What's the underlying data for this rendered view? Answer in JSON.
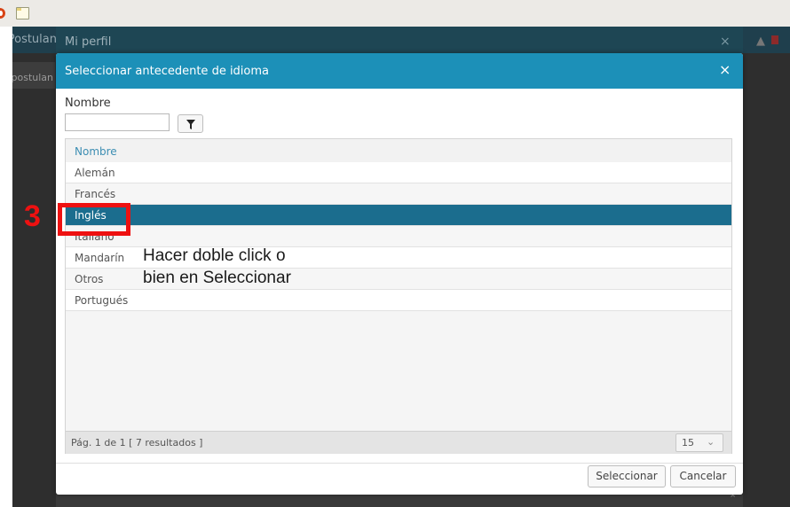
{
  "background": {
    "left_title_fragment": "Postulan",
    "side_fragment": "postulan",
    "outer_dialog_title": "Mi perfil",
    "outer_close": "×"
  },
  "modal": {
    "title": "Seleccionar antecedente de idioma",
    "close_glyph": "×",
    "filter_label": "Nombre",
    "filter_value": "",
    "grid": {
      "column_header": "Nombre",
      "rows": [
        "Alemán",
        "Francés",
        "Inglés",
        "Italiano",
        "Mandarín",
        "Otros",
        "Portugués"
      ],
      "selected_index": 2,
      "pagination": "Pág. 1 de 1 [ 7 resultados ]",
      "page_size": "15"
    },
    "buttons": {
      "select": "Seleccionar",
      "cancel": "Cancelar"
    }
  },
  "annotation": {
    "step_number": "3",
    "instruction_line1": "Hacer doble click o",
    "instruction_line2": "bien en Seleccionar",
    "color": "#ee1111"
  },
  "colors": {
    "header": "#1c90b8",
    "selected_row": "#1b6d8e",
    "column_header_text": "#3d8eb3"
  }
}
